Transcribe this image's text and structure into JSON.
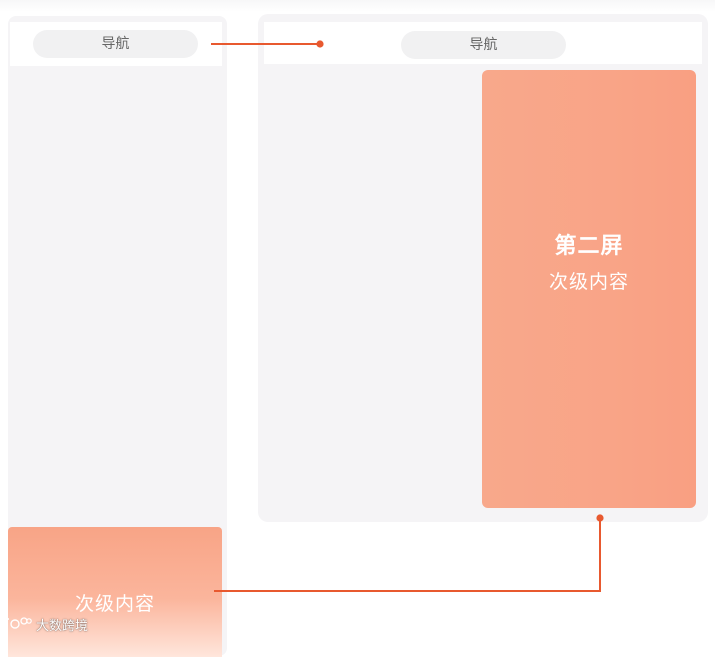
{
  "left_screen": {
    "nav_label": "导航",
    "secondary_label": "次级内容"
  },
  "right_screen": {
    "nav_label": "导航",
    "title": "第二屏",
    "subtitle": "次级内容"
  },
  "watermark": {
    "text": "大数跨境",
    "logo_icon": "tt-logo-icon"
  },
  "colors": {
    "accent_line": "#e8592f",
    "block_fill": "#f9a487",
    "phone_bg": "#f5f4f6",
    "pill_bg": "#f1f1f2"
  }
}
